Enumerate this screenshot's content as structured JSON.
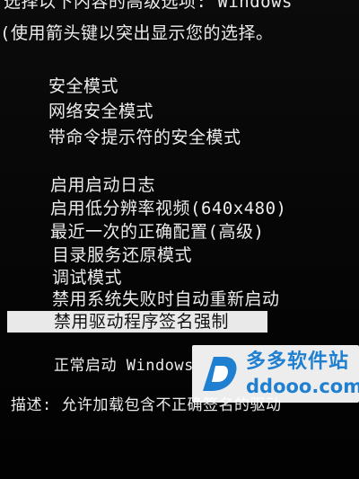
{
  "header": {
    "line1": "选择以下内容的高级选项: Windows",
    "line2": "(使用箭头键以突出显示您的选择。"
  },
  "menu": {
    "group1": [
      "安全模式",
      "网络安全模式",
      "带命令提示符的安全模式"
    ],
    "group2": [
      "启用启动日志",
      "启用低分辨率视频(640x480)",
      "最近一次的正确配置(高级)",
      "目录服务还原模式",
      "调试模式",
      "禁用系统失败时自动重新启动",
      "禁用驱动程序签名强制"
    ],
    "selected_item": "禁用驱动程序签名强制",
    "normal_start": "正常启动 Windows"
  },
  "description": "描述: 允许加载包含不正确签名的驱动",
  "watermark": {
    "title": "多多软件站",
    "url": "ddooo.com",
    "icon": "ddooo-logo-icon",
    "color": "#1f7fd0"
  }
}
